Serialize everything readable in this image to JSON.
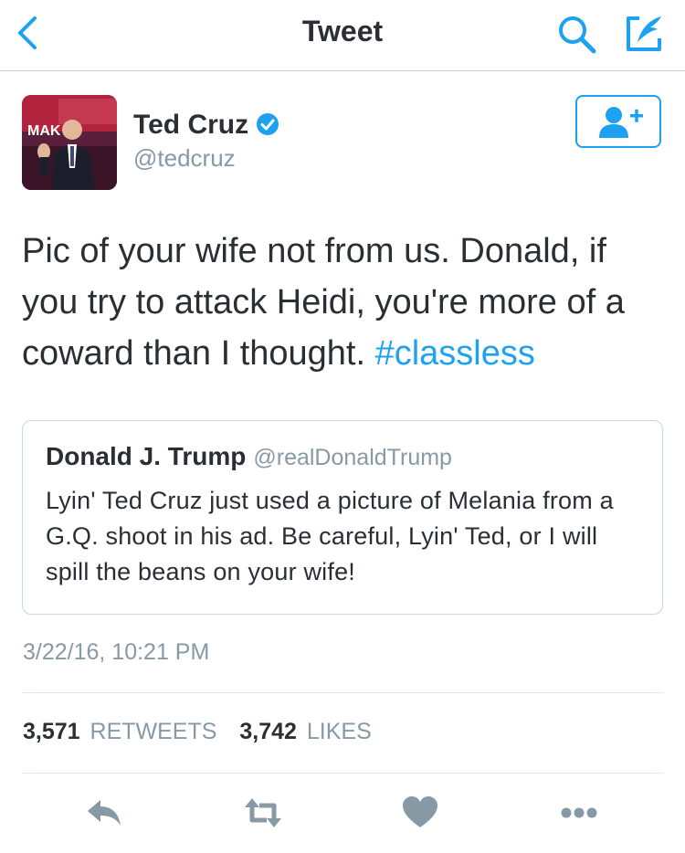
{
  "navbar": {
    "title": "Tweet",
    "accent": "#1da1f2",
    "icons": [
      "back-icon",
      "search-icon",
      "compose-icon"
    ]
  },
  "author": {
    "name": "Ted Cruz",
    "handle": "@tedcruz",
    "verified": true,
    "avatar_backdrop_text": "MAK",
    "follow_icon": "add-user-icon"
  },
  "tweet": {
    "text_main": "Pic of your wife not from us. Donald, if you try to attack Heidi, you're more of a coward than I thought.",
    "hashtag": "#classless",
    "timestamp": "3/22/16, 10:21 PM"
  },
  "quoted": {
    "name": "Donald J. Trump",
    "handle": "@realDonaldTrump",
    "text": "Lyin' Ted Cruz just used a picture of Melania from a G.Q. shoot in his ad. Be careful, Lyin' Ted, or I will spill the beans on your wife!"
  },
  "stats": {
    "retweets_count": "3,571",
    "retweets_label": "RETWEETS",
    "likes_count": "3,742",
    "likes_label": "LIKES"
  },
  "actions": [
    "reply-icon",
    "retweet-icon",
    "like-icon",
    "more-icon"
  ],
  "colors": {
    "text": "#292f33",
    "secondary": "#8899a6",
    "action_gray": "#8899a6"
  }
}
